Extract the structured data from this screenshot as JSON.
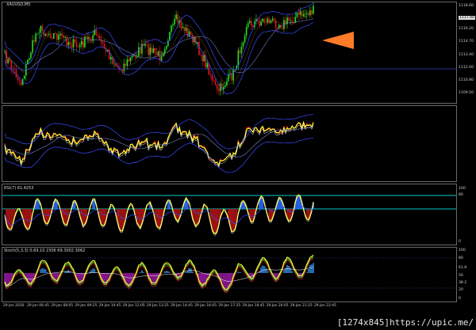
{
  "main_chart": {
    "symbol_label": "XAUUSD,M5",
    "price_labels": [
      "1118.60",
      "1117.40",
      "1116.20",
      "1114.70",
      "1113.40",
      "1112.00",
      "1110.80",
      "1109.50"
    ],
    "current_price": "1117.40",
    "marker_color": "#ff7b28"
  },
  "indicator_2": {
    "title": "",
    "labels": []
  },
  "rsi_panel": {
    "title": "RSI(7) 61.4253",
    "labels": [
      "100",
      "80",
      "0"
    ]
  },
  "stoch_panel": {
    "title": "Stoch(5,3,3) 0.69.10 2306 69.3002.3062",
    "labels": [
      "100",
      "80",
      "61.8",
      "50",
      "38.2",
      "20",
      "0"
    ]
  },
  "time_axis": [
    "29 Jan 2016",
    "29 Jan 06:45",
    "29 Jan 08:05",
    "29 Jan 09:25",
    "29 Jan 10:45",
    "29 Jan 12:05",
    "29 Jan 13:25",
    "29 Jan 14:45",
    "29 Jan 16:05",
    "29 Jan 17:25",
    "29 Jan 18:45",
    "29 Jan 20:05",
    "29 Jan 21:25",
    "29 Jan 22:45"
  ],
  "watermark": "[1274x845]https://upic.me/",
  "colors": {
    "background": "#000000",
    "candle_up": "#22e022",
    "candle_down": "#e01818",
    "fast_line": "#ffff33",
    "band": "#3a4cff",
    "accent": "#ff7b28",
    "cyan_level": "#00c8c8",
    "hist_blue": "#2a6cff",
    "hist_red": "#b01515",
    "hist_purple": "#9b1aa6"
  }
}
